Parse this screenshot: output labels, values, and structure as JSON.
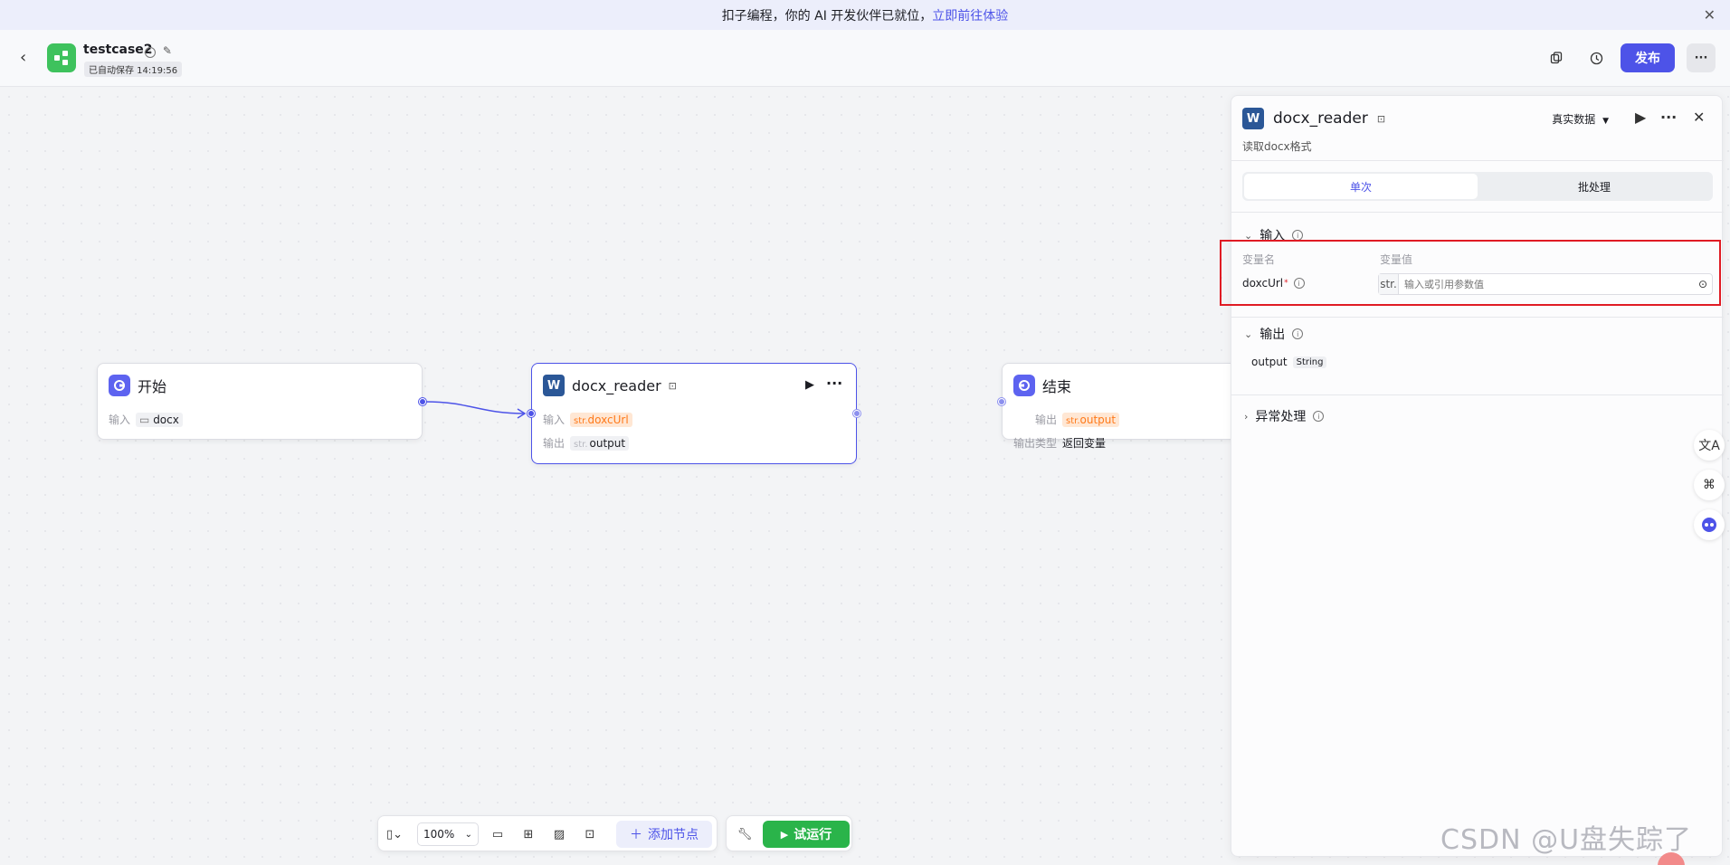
{
  "banner": {
    "text": "扣子编程，你的 AI 开发伙伴已就位，",
    "link": "立即前往体验",
    "close_icon": "close-icon"
  },
  "header": {
    "title": "testcase2",
    "autosave": "已自动保存 14:19:56",
    "publish_label": "发布"
  },
  "nodes": {
    "start": {
      "title": "开始",
      "input_label": "输入",
      "input_value": "docx"
    },
    "reader": {
      "title": "docx_reader",
      "input_label": "输入",
      "input_type": "str.",
      "input_value": "doxcUrl",
      "output_label": "输出",
      "output_type": "str.",
      "output_value": "output"
    },
    "end": {
      "title": "结束",
      "output_label": "输出",
      "output_type": "str.",
      "output_value": "output",
      "output_kind_label": "输出类型",
      "output_kind_value": "返回变量"
    }
  },
  "panel": {
    "title": "docx_reader",
    "description": "读取docx格式",
    "mode": "真实数据",
    "tabs": [
      "单次",
      "批处理"
    ],
    "input_section": "输入",
    "col_name": "变量名",
    "col_value": "变量值",
    "var_name": "doxcUrl",
    "var_type": "str.",
    "var_placeholder": "输入或引用参数值",
    "output_section": "输出",
    "output_name": "output",
    "output_type": "String",
    "error_section": "异常处理"
  },
  "toolbar": {
    "zoom": "100%",
    "add_node": "添加节点",
    "trial_run": "试运行"
  },
  "watermark": "CSDN @U盘失踪了",
  "colors": {
    "accent": "#4d53e8",
    "run_green": "#2ab44a",
    "highlight_red": "#e01b24",
    "var_orange": "#ff7a1a"
  }
}
